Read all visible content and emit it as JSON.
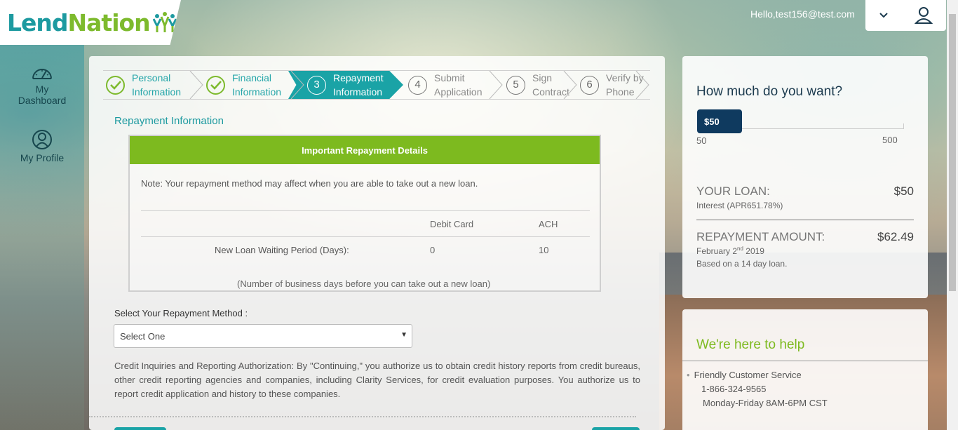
{
  "brand": {
    "name_part1": "Lend",
    "name_part2": "Nation",
    "colors": {
      "teal": "#1d9aa0",
      "green": "#7dba2d",
      "navy": "#0f3a5f"
    }
  },
  "header": {
    "greeting": "Hello,test156@test.com",
    "icons": [
      "chevron-down-icon",
      "user-icon"
    ]
  },
  "sidebar": {
    "items": [
      {
        "label_line1": "My",
        "label_line2": "Dashboard",
        "icon": "dashboard-gauge-icon"
      },
      {
        "label": "My Profile",
        "icon": "profile-icon"
      }
    ]
  },
  "steps": [
    {
      "num": "1",
      "line1": "Personal",
      "line2": "Information",
      "state": "complete"
    },
    {
      "num": "2",
      "line1": "Financial",
      "line2": "Information",
      "state": "complete"
    },
    {
      "num": "3",
      "line1": "Repayment",
      "line2": "Information",
      "state": "active"
    },
    {
      "num": "4",
      "line1": "Submit",
      "line2": "Application",
      "state": "pending"
    },
    {
      "num": "5",
      "line1": "Sign",
      "line2": "Contract",
      "state": "pending"
    },
    {
      "num": "6",
      "line1": "Verify by",
      "line2": "Phone",
      "state": "pending"
    }
  ],
  "repayment": {
    "section_title": "Repayment Information",
    "details_header": "Important Repayment Details",
    "note": "Note: Your repayment method may affect when you are able to take out a new loan.",
    "table": {
      "columns": [
        "Debit Card",
        "ACH"
      ],
      "row_label": "New Loan Waiting Period (Days):",
      "values": [
        "0",
        "10"
      ]
    },
    "footnote": "(Number of business days before you can take out a new loan)",
    "method_label": "Select Your Repayment Method :",
    "method_selected": "Select One",
    "authorization": "Credit Inquiries and Reporting Authorization: By \"Continuing,\" you authorize us to obtain credit history reports from credit bureaus, other credit reporting agencies and companies, including Clarity Services, for credit evaluation purposes. You authorize us to report credit application and history to these companies."
  },
  "loan": {
    "question": "How much do you want?",
    "slider_value": "$50",
    "slider_min": "50",
    "slider_max": "500",
    "your_loan_label": "YOUR LOAN:",
    "your_loan_value": "$50",
    "interest": "Interest (APR651.78%)",
    "repayment_label": "REPAYMENT AMOUNT:",
    "repayment_value": "$62.49",
    "due_month": "February 2",
    "due_sup": "nd",
    "due_year": " 2019",
    "based_on": "Based on a 14 day loan."
  },
  "help": {
    "title": "We're here to help",
    "item_title": "Friendly Customer Service",
    "phone": "1-866-324-9565",
    "hours": "Monday-Friday 8AM-6PM CST"
  }
}
